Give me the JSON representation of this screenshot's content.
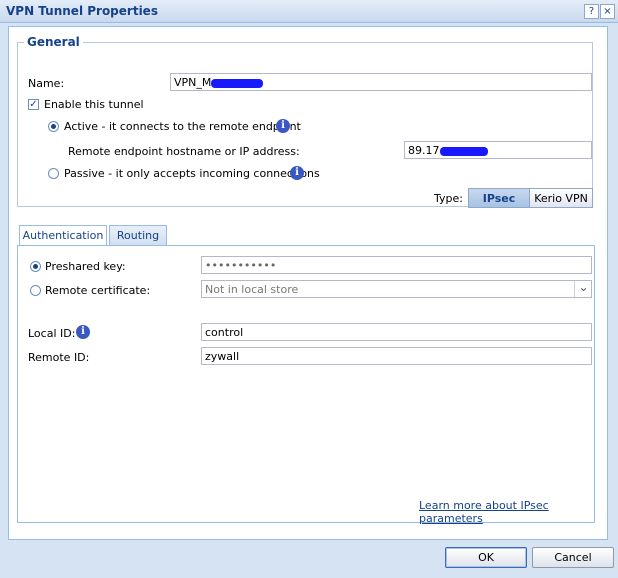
{
  "window": {
    "title": "VPN Tunnel Properties",
    "help_glyph": "?",
    "close_glyph": "×"
  },
  "general": {
    "legend": "General",
    "name_label": "Name:",
    "name_value": "VPN_M",
    "enable_label": "Enable this tunnel",
    "enable_checked": true,
    "active_label": "Active - it connects to the remote endpoint",
    "remote_label": "Remote endpoint hostname or IP address:",
    "remote_value": "89.17",
    "passive_label": "Passive - it only accepts incoming connections",
    "type_label": "Type:",
    "type_options": [
      "IPsec",
      "Kerio VPN"
    ],
    "type_selected": "IPsec",
    "check_glyph": "✓",
    "info_glyph": "i"
  },
  "tabs": [
    {
      "label": "Authentication",
      "active": true
    },
    {
      "label": "Routing",
      "active": false
    }
  ],
  "auth": {
    "preshared_label": "Preshared key:",
    "preshared_value": "•••••••••••",
    "remote_cert_label": "Remote certificate:",
    "remote_cert_value": "Not in local store",
    "dropdown_glyph": "⌄",
    "local_id_label": "Local ID:",
    "local_id_value": "control",
    "remote_id_label": "Remote ID:",
    "remote_id_value": "zywall",
    "learn_more": "Learn more about IPsec parameters"
  },
  "buttons": {
    "ok": "OK",
    "cancel": "Cancel"
  }
}
